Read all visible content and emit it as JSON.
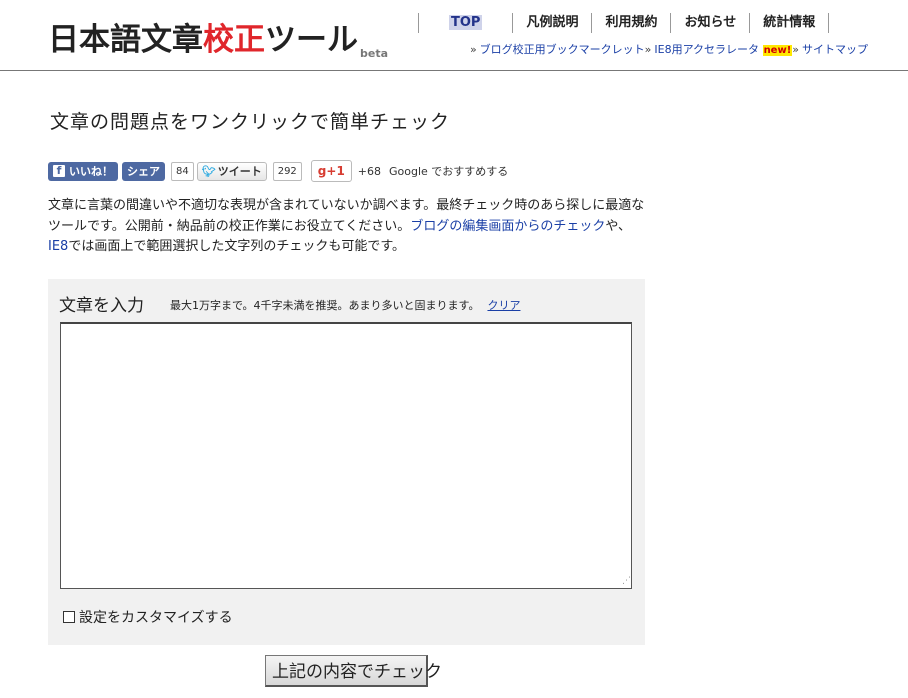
{
  "logo": {
    "part1": "日本語文章",
    "accent": "校正",
    "part2": "ツール",
    "badge": "beta"
  },
  "nav": {
    "items": [
      "TOP",
      "凡例説明",
      "利用規約",
      "お知らせ",
      "統計情報"
    ]
  },
  "subnav": {
    "link1": "ブログ校正用ブックマークレット",
    "link2": "IE8用アクセラレータ",
    "new_badge": "new!",
    "link3": "サイトマップ"
  },
  "headline": "文章の問題点をワンクリックで簡単チェック",
  "social": {
    "like": "いいね！",
    "share": "シェア",
    "share_count": "84",
    "tweet": "ツイート",
    "tweet_count": "292",
    "gplus": "g+1",
    "gplus_count": "+68",
    "gplus_text": "Google でおすすめする"
  },
  "description": {
    "p1": "文章に言葉の間違いや不適切な表現が含まれていないか調べます。最終チェック時のあら探しに最適なツールです。公開前・納品前の校正作業にお役立てください。",
    "link1": "ブログの編集画面からのチェック",
    "p2": "や、",
    "link2": "IE8",
    "p3": "では画面上で範囲選択した文字列のチェックも可能です。"
  },
  "form": {
    "title": "文章を入力",
    "note": "最大1万字まで。4千字未満を推奨。あまり多いと固まります。",
    "clear_label": "クリア",
    "textarea_value": "",
    "customize_label": "設定をカスタマイズする",
    "customize_checked": false,
    "submit_label": "上記の内容でチェック"
  }
}
